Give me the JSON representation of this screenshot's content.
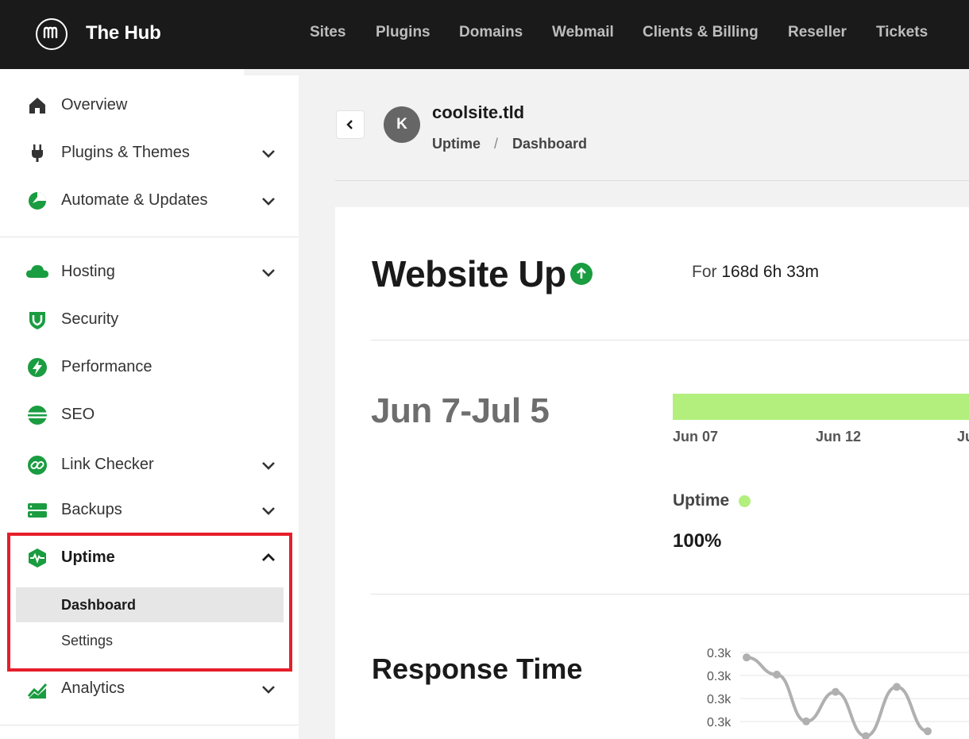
{
  "brand": {
    "name": "The Hub",
    "logo_icon": "wpmudev-logo-icon"
  },
  "topnav": [
    "Sites",
    "Plugins",
    "Domains",
    "Webmail",
    "Clients & Billing",
    "Reseller",
    "Tickets"
  ],
  "sidebar": {
    "items": [
      {
        "label": "Overview",
        "icon": "home-icon",
        "has_chevron": false
      },
      {
        "label": "Plugins & Themes",
        "icon": "plug-icon",
        "has_chevron": true
      },
      {
        "label": "Automate & Updates",
        "icon": "automate-icon",
        "has_chevron": true
      },
      {
        "label": "Hosting",
        "icon": "cloud-icon",
        "has_chevron": true
      },
      {
        "label": "Security",
        "icon": "shield-icon",
        "has_chevron": true
      },
      {
        "label": "Performance",
        "icon": "bolt-icon",
        "has_chevron": false
      },
      {
        "label": "SEO",
        "icon": "seo-icon",
        "has_chevron": false
      },
      {
        "label": "Link Checker",
        "icon": "link-icon",
        "has_chevron": true
      },
      {
        "label": "Backups",
        "icon": "backups-icon",
        "has_chevron": true
      },
      {
        "label": "Uptime",
        "icon": "uptime-icon",
        "has_chevron": true,
        "expanded": true
      },
      {
        "label": "Analytics",
        "icon": "analytics-icon",
        "has_chevron": true
      }
    ],
    "uptime_sub": [
      {
        "label": "Dashboard",
        "active": true
      },
      {
        "label": "Settings",
        "active": false
      }
    ]
  },
  "header": {
    "avatar_letter": "K",
    "site_name": "coolsite.tld",
    "breadcrumb": [
      "Uptime",
      "Dashboard"
    ],
    "breadcrumb_sep": "/"
  },
  "status": {
    "title": "Website Up",
    "for_prefix": "For",
    "duration": "168d 6h 33m"
  },
  "period": {
    "range": "Jun 7-Jul 5",
    "ticks": [
      "Jun 07",
      "Jun 12",
      "Ju"
    ],
    "uptime_label": "Uptime",
    "uptime_value": "100%"
  },
  "response": {
    "title": "Response Time"
  },
  "chart_data": {
    "type": "line",
    "title": "Response Time",
    "y_tick_labels": [
      "0.3k",
      "0.3k",
      "0.3k",
      "0.3k"
    ],
    "series": [
      {
        "values": [
          0.29,
          0.255,
          0.16,
          0.22,
          0.13,
          0.23,
          0.14
        ]
      }
    ],
    "grid": true
  },
  "colors": {
    "accent_green": "#1a9c40",
    "bar_green": "#b3ef7c",
    "highlight_red": "#e61e2b",
    "topbar": "#1a1a1a"
  }
}
